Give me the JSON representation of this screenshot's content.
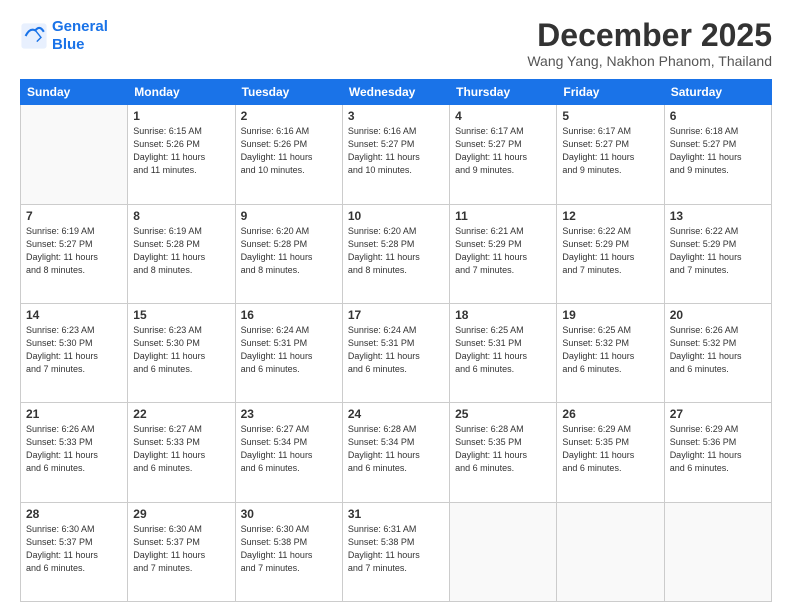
{
  "logo": {
    "line1": "General",
    "line2": "Blue"
  },
  "title": "December 2025",
  "subtitle": "Wang Yang, Nakhon Phanom, Thailand",
  "headers": [
    "Sunday",
    "Monday",
    "Tuesday",
    "Wednesday",
    "Thursday",
    "Friday",
    "Saturday"
  ],
  "weeks": [
    [
      {
        "day": "",
        "info": ""
      },
      {
        "day": "1",
        "info": "Sunrise: 6:15 AM\nSunset: 5:26 PM\nDaylight: 11 hours\nand 11 minutes."
      },
      {
        "day": "2",
        "info": "Sunrise: 6:16 AM\nSunset: 5:26 PM\nDaylight: 11 hours\nand 10 minutes."
      },
      {
        "day": "3",
        "info": "Sunrise: 6:16 AM\nSunset: 5:27 PM\nDaylight: 11 hours\nand 10 minutes."
      },
      {
        "day": "4",
        "info": "Sunrise: 6:17 AM\nSunset: 5:27 PM\nDaylight: 11 hours\nand 9 minutes."
      },
      {
        "day": "5",
        "info": "Sunrise: 6:17 AM\nSunset: 5:27 PM\nDaylight: 11 hours\nand 9 minutes."
      },
      {
        "day": "6",
        "info": "Sunrise: 6:18 AM\nSunset: 5:27 PM\nDaylight: 11 hours\nand 9 minutes."
      }
    ],
    [
      {
        "day": "7",
        "info": "Sunrise: 6:19 AM\nSunset: 5:27 PM\nDaylight: 11 hours\nand 8 minutes."
      },
      {
        "day": "8",
        "info": "Sunrise: 6:19 AM\nSunset: 5:28 PM\nDaylight: 11 hours\nand 8 minutes."
      },
      {
        "day": "9",
        "info": "Sunrise: 6:20 AM\nSunset: 5:28 PM\nDaylight: 11 hours\nand 8 minutes."
      },
      {
        "day": "10",
        "info": "Sunrise: 6:20 AM\nSunset: 5:28 PM\nDaylight: 11 hours\nand 8 minutes."
      },
      {
        "day": "11",
        "info": "Sunrise: 6:21 AM\nSunset: 5:29 PM\nDaylight: 11 hours\nand 7 minutes."
      },
      {
        "day": "12",
        "info": "Sunrise: 6:22 AM\nSunset: 5:29 PM\nDaylight: 11 hours\nand 7 minutes."
      },
      {
        "day": "13",
        "info": "Sunrise: 6:22 AM\nSunset: 5:29 PM\nDaylight: 11 hours\nand 7 minutes."
      }
    ],
    [
      {
        "day": "14",
        "info": "Sunrise: 6:23 AM\nSunset: 5:30 PM\nDaylight: 11 hours\nand 7 minutes."
      },
      {
        "day": "15",
        "info": "Sunrise: 6:23 AM\nSunset: 5:30 PM\nDaylight: 11 hours\nand 6 minutes."
      },
      {
        "day": "16",
        "info": "Sunrise: 6:24 AM\nSunset: 5:31 PM\nDaylight: 11 hours\nand 6 minutes."
      },
      {
        "day": "17",
        "info": "Sunrise: 6:24 AM\nSunset: 5:31 PM\nDaylight: 11 hours\nand 6 minutes."
      },
      {
        "day": "18",
        "info": "Sunrise: 6:25 AM\nSunset: 5:31 PM\nDaylight: 11 hours\nand 6 minutes."
      },
      {
        "day": "19",
        "info": "Sunrise: 6:25 AM\nSunset: 5:32 PM\nDaylight: 11 hours\nand 6 minutes."
      },
      {
        "day": "20",
        "info": "Sunrise: 6:26 AM\nSunset: 5:32 PM\nDaylight: 11 hours\nand 6 minutes."
      }
    ],
    [
      {
        "day": "21",
        "info": "Sunrise: 6:26 AM\nSunset: 5:33 PM\nDaylight: 11 hours\nand 6 minutes."
      },
      {
        "day": "22",
        "info": "Sunrise: 6:27 AM\nSunset: 5:33 PM\nDaylight: 11 hours\nand 6 minutes."
      },
      {
        "day": "23",
        "info": "Sunrise: 6:27 AM\nSunset: 5:34 PM\nDaylight: 11 hours\nand 6 minutes."
      },
      {
        "day": "24",
        "info": "Sunrise: 6:28 AM\nSunset: 5:34 PM\nDaylight: 11 hours\nand 6 minutes."
      },
      {
        "day": "25",
        "info": "Sunrise: 6:28 AM\nSunset: 5:35 PM\nDaylight: 11 hours\nand 6 minutes."
      },
      {
        "day": "26",
        "info": "Sunrise: 6:29 AM\nSunset: 5:35 PM\nDaylight: 11 hours\nand 6 minutes."
      },
      {
        "day": "27",
        "info": "Sunrise: 6:29 AM\nSunset: 5:36 PM\nDaylight: 11 hours\nand 6 minutes."
      }
    ],
    [
      {
        "day": "28",
        "info": "Sunrise: 6:30 AM\nSunset: 5:37 PM\nDaylight: 11 hours\nand 6 minutes."
      },
      {
        "day": "29",
        "info": "Sunrise: 6:30 AM\nSunset: 5:37 PM\nDaylight: 11 hours\nand 7 minutes."
      },
      {
        "day": "30",
        "info": "Sunrise: 6:30 AM\nSunset: 5:38 PM\nDaylight: 11 hours\nand 7 minutes."
      },
      {
        "day": "31",
        "info": "Sunrise: 6:31 AM\nSunset: 5:38 PM\nDaylight: 11 hours\nand 7 minutes."
      },
      {
        "day": "",
        "info": ""
      },
      {
        "day": "",
        "info": ""
      },
      {
        "day": "",
        "info": ""
      }
    ]
  ]
}
